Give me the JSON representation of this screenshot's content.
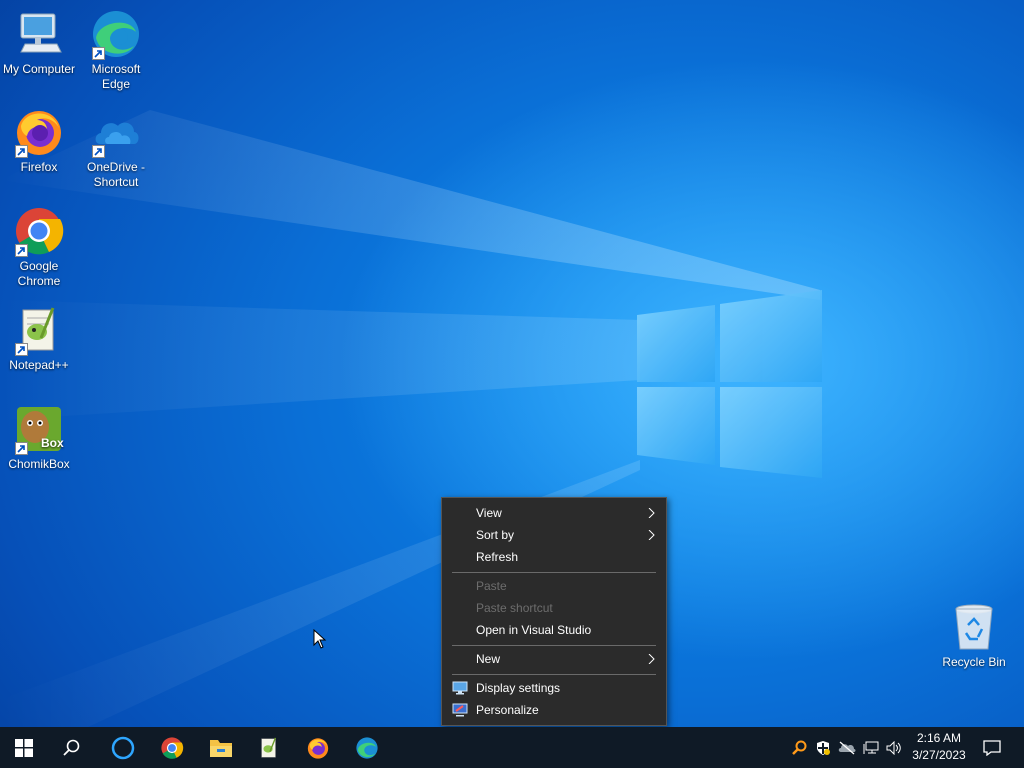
{
  "desktop": {
    "icons": [
      {
        "label": "My Computer",
        "icon": "computer-icon"
      },
      {
        "label": "Microsoft Edge",
        "icon": "edge-icon"
      },
      {
        "label": "Firefox",
        "icon": "firefox-icon"
      },
      {
        "label": "OneDrive - Shortcut",
        "icon": "onedrive-icon"
      },
      {
        "label": "Google Chrome",
        "icon": "chrome-icon"
      },
      {
        "label": "Notepad++",
        "icon": "notepadpp-icon"
      },
      {
        "label": "ChomikBox",
        "icon": "chomikbox-icon"
      },
      {
        "label": "Recycle Bin",
        "icon": "recycle-bin-icon"
      }
    ]
  },
  "context_menu": {
    "items": [
      {
        "label": "View",
        "has_submenu": true,
        "enabled": true
      },
      {
        "label": "Sort by",
        "has_submenu": true,
        "enabled": true
      },
      {
        "label": "Refresh",
        "has_submenu": false,
        "enabled": true
      },
      {
        "label": "Paste",
        "has_submenu": false,
        "enabled": false
      },
      {
        "label": "Paste shortcut",
        "has_submenu": false,
        "enabled": false
      },
      {
        "label": "Open in Visual Studio",
        "has_submenu": false,
        "enabled": true
      },
      {
        "label": "New",
        "has_submenu": true,
        "enabled": true
      },
      {
        "label": "Display settings",
        "has_submenu": false,
        "enabled": true,
        "icon": "display-icon"
      },
      {
        "label": "Personalize",
        "has_submenu": false,
        "enabled": true,
        "icon": "personalize-icon"
      }
    ]
  },
  "taskbar": {
    "pinned": [
      "start-icon",
      "search-icon",
      "cortana-icon",
      "chrome-icon",
      "file-explorer-icon",
      "notepadpp-icon",
      "firefox-icon",
      "edge-icon"
    ],
    "tray": [
      "search-tool-icon",
      "defender-icon",
      "onedrive-offline-icon",
      "network-icon",
      "volume-icon"
    ],
    "time": "2:16 AM",
    "date": "3/27/2023"
  },
  "colors": {
    "taskbar": "#0f1a26",
    "menu_bg": "#2b2b2b",
    "accent": "#0a78e6"
  }
}
